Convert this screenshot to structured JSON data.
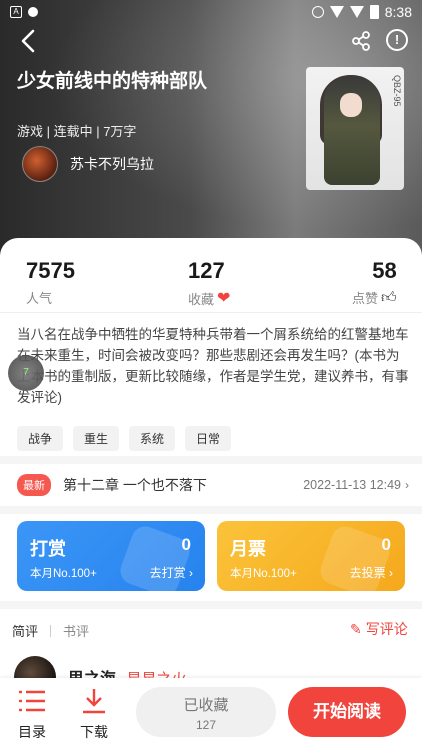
{
  "status_bar": {
    "time": "8:38",
    "left_icons": [
      "A",
      "notification-dot"
    ]
  },
  "book": {
    "title": "少女前线中的特种部队",
    "meta": "游戏 | 连载中 | 7万字",
    "author": "苏卡不列乌拉",
    "cover_side_text": "QBZ-95"
  },
  "stats": {
    "popularity_value": "7575",
    "popularity_label": "人气",
    "favorites_value": "127",
    "favorites_label": "收藏",
    "likes_value": "58",
    "likes_label": "点赞"
  },
  "description": "当八名在战争中牺牲的华夏特种兵带着一个屑系统给的红警基地车在未来重生，时间会被改变吗？那些悲剧还会再发生吗？(本书为上本书的重制版，更新比较随缘，作者是学生党，建议养书，有事发评论)",
  "tags": [
    "战争",
    "重生",
    "系统",
    "日常"
  ],
  "latest_chapter": {
    "badge": "最新",
    "title": "第十二章  一个也不落下",
    "date": "2022-11-13 12:49"
  },
  "reward": {
    "title": "打赏",
    "count": "0",
    "rank": "本月No.100+",
    "action": "去打赏",
    "color": "#2c8df5"
  },
  "monthly_ticket": {
    "title": "月票",
    "count": "0",
    "rank": "本月No.100+",
    "action": "去投票",
    "color": "#f7b21f"
  },
  "review_tabs": [
    "简评",
    "书评"
  ],
  "write_review": "写评论",
  "first_review": {
    "name": "思之海",
    "tag": "星星之火"
  },
  "bottom_bar": {
    "catalog": "目录",
    "download": "下载",
    "collected": "已收藏",
    "collected_count": "127",
    "start_reading": "开始阅读"
  },
  "floating_ball_text": "7"
}
